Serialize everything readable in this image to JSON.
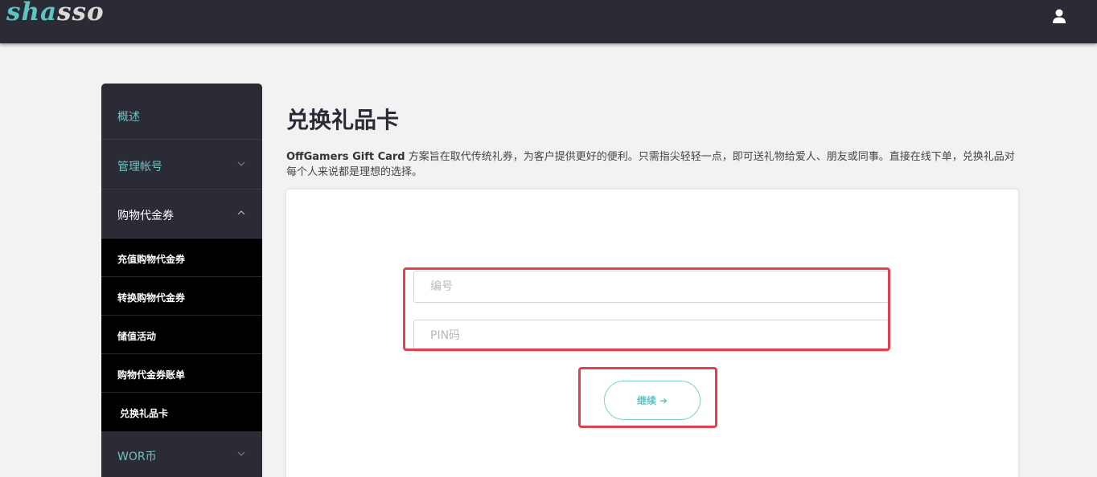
{
  "header": {
    "logo_part1": "sha",
    "logo_part2": "sso",
    "user_icon": "user-icon"
  },
  "sidebar": {
    "items": [
      {
        "label": "概述"
      },
      {
        "label": "管理帐号"
      },
      {
        "label": "购物代金券"
      },
      {
        "label": "WOR币"
      }
    ],
    "sub_items": [
      {
        "label": "充值购物代金券"
      },
      {
        "label": "转换购物代金券"
      },
      {
        "label": "储值活动"
      },
      {
        "label": "购物代金券账单"
      },
      {
        "label": "兑换礼品卡"
      }
    ]
  },
  "main": {
    "title": "兑换礼品卡",
    "desc_bold": "OffGamers Gift Card",
    "desc_rest": " 方案旨在取代传统礼券，为客户提供更好的便利。只需指尖轻轻一点，即可送礼物给爱人、朋友或同事。直接在线下单，兑换礼品对每个人来说都是理想的选择。",
    "serial_placeholder": "编号",
    "pin_placeholder": "PIN码",
    "continue_label": "继续",
    "continue_arrow": "➜"
  },
  "colors": {
    "accent": "#5fc3c0",
    "topbar": "#2b2b35",
    "highlight": "#e0414f"
  }
}
